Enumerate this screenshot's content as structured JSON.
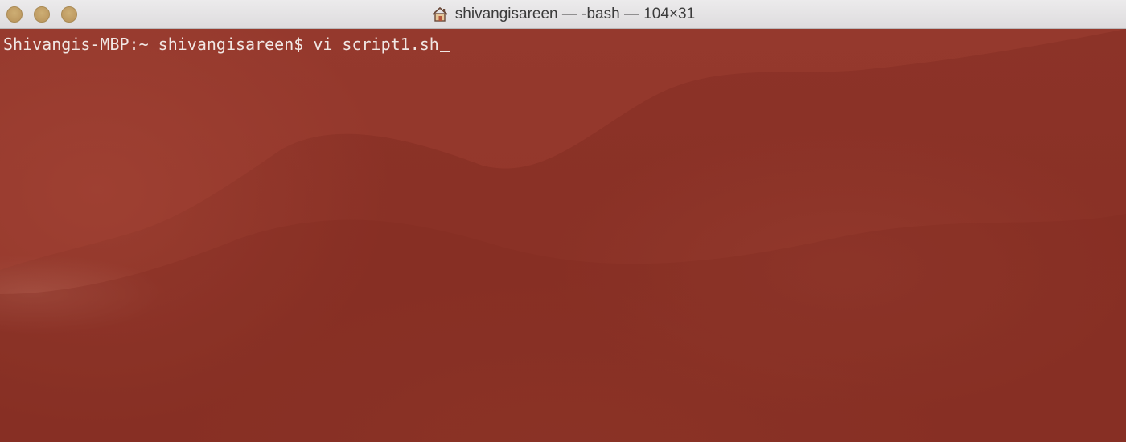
{
  "window": {
    "title": "shivangisareen — -bash — 104×31",
    "title_icon": "home-icon",
    "traffic_lights": {
      "close_color": "#c4a26a",
      "minimize_color": "#c4a26a",
      "zoom_color": "#c4a26a"
    }
  },
  "terminal": {
    "background_color": "#8a3226",
    "text_color": "#f1e7e4",
    "prompt": "Shivangis-MBP:~ shivangisareen$ ",
    "command": "vi script1.sh"
  }
}
